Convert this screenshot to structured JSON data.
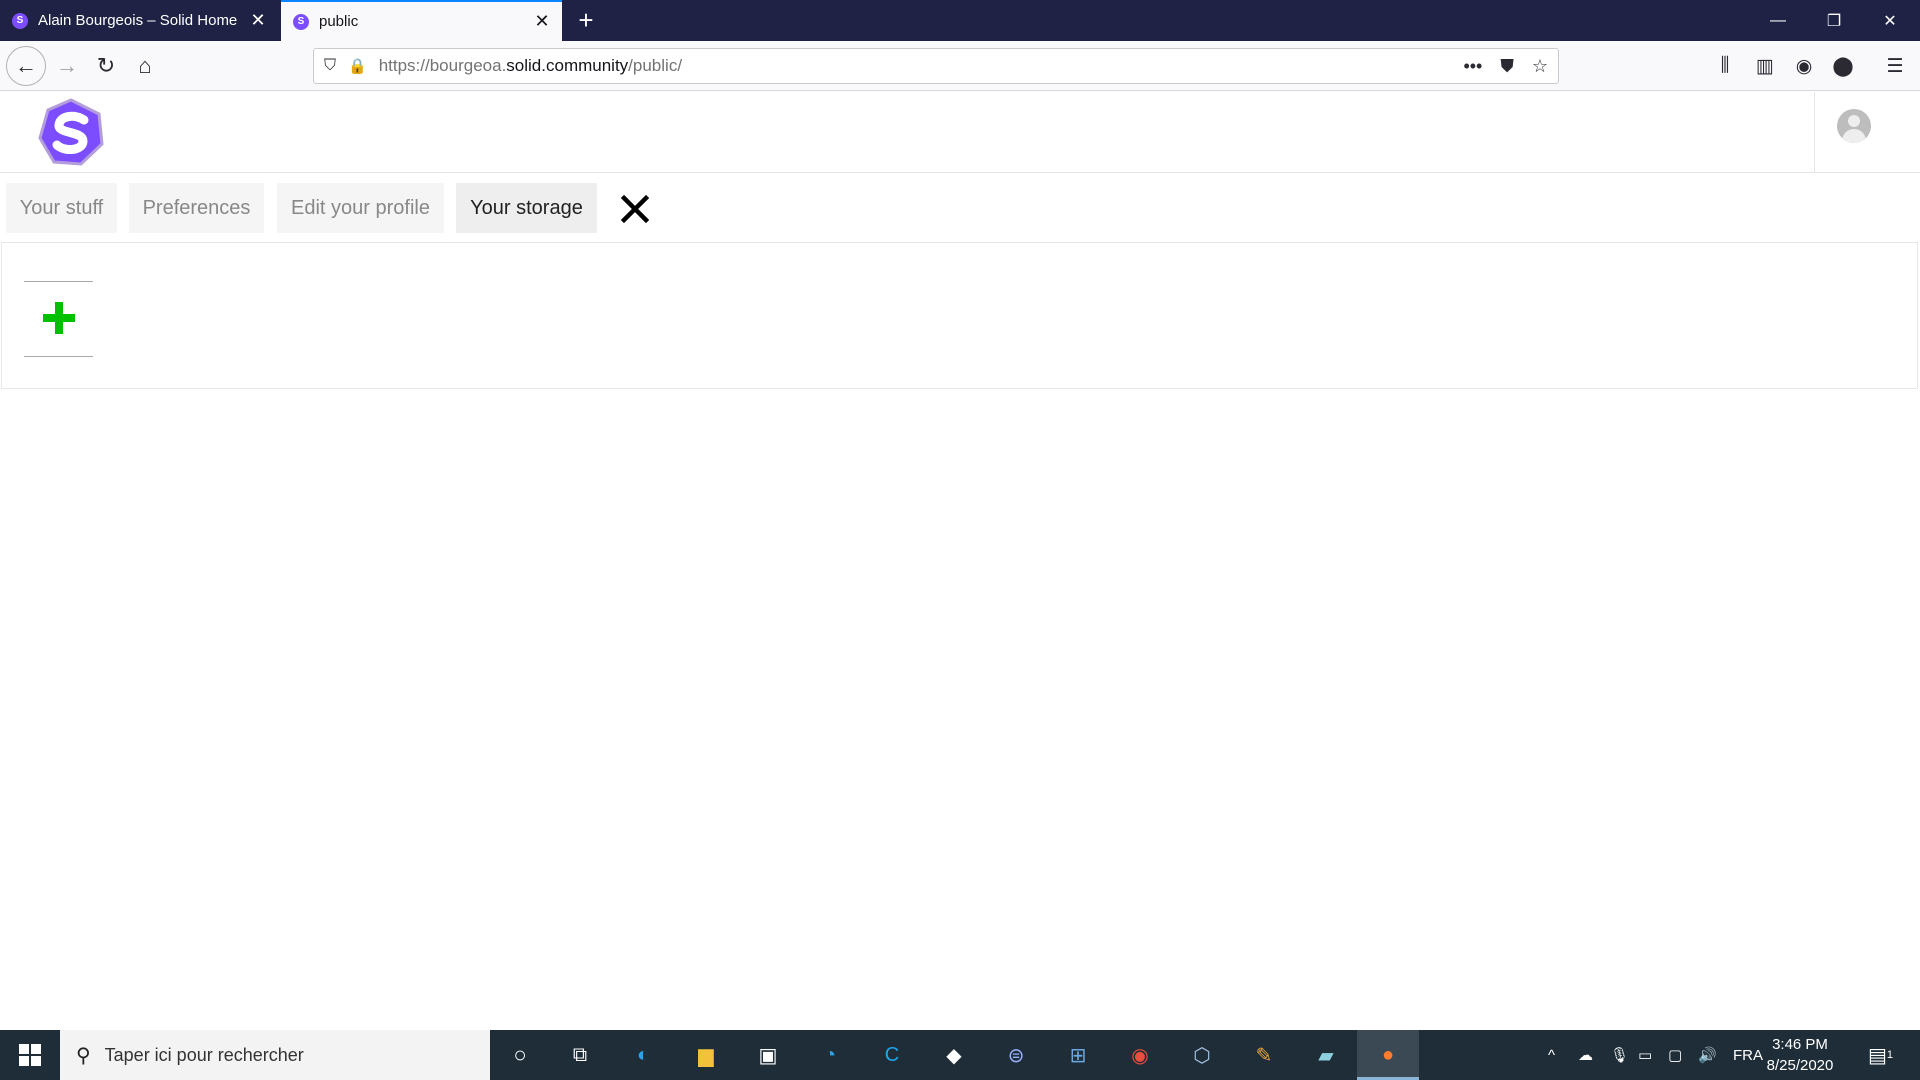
{
  "browser": {
    "tabs": [
      {
        "title": "Alain Bourgeois – Solid Home",
        "active": false
      },
      {
        "title": "public",
        "active": true
      }
    ],
    "url": {
      "prefix": "https://bourgeoa.",
      "domain": "solid.community",
      "path": "/public/"
    }
  },
  "app": {
    "tabs": [
      {
        "label": "Your stuff",
        "active": false
      },
      {
        "label": "Preferences",
        "active": false
      },
      {
        "label": "Edit your profile",
        "active": false
      },
      {
        "label": "Your storage",
        "active": true
      }
    ],
    "logo_letter": "S",
    "accent_color": "#7c4dff",
    "add_icon_color": "#00c000"
  },
  "taskbar": {
    "search_placeholder": "Taper ici pour rechercher",
    "language": "FRA",
    "time": "3:46 PM",
    "date": "8/25/2020",
    "notification_count": "1"
  }
}
